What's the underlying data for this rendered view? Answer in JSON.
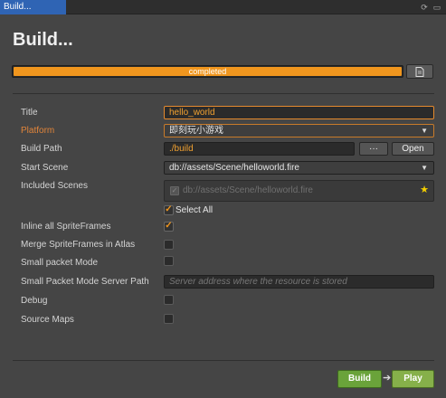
{
  "window": {
    "tab_title": "Build...",
    "icons": [
      "refresh-icon",
      "window-icon"
    ]
  },
  "heading": "Build...",
  "progress": {
    "percent": 100,
    "status_text": "completed",
    "fill_color": "#f0961e"
  },
  "form": {
    "title_label": "Title",
    "title_value": "hello_world",
    "platform_label": "Platform",
    "platform_value": "即刻玩小游戏",
    "build_path_label": "Build Path",
    "build_path_value": "./build",
    "browse_label": "···",
    "open_label": "Open",
    "start_scene_label": "Start Scene",
    "start_scene_value": "db://assets/Scene/helloworld.fire",
    "included_scenes_label": "Included Scenes",
    "included_scene_item": "db://assets/Scene/helloworld.fire",
    "select_all_label": "Select All",
    "select_all_checked": true,
    "inline_spriteframes_label": "Inline all SpriteFrames",
    "inline_spriteframes_checked": true,
    "merge_spriteframes_label": "Merge SpriteFrames in Atlas",
    "merge_spriteframes_checked": false,
    "small_packet_label": "Small packet Mode",
    "small_packet_checked": false,
    "small_packet_server_label": "Small Packet Mode Server Path",
    "small_packet_server_placeholder": "Server address where the resource is stored",
    "debug_label": "Debug",
    "debug_checked": false,
    "source_maps_label": "Source Maps",
    "source_maps_checked": false
  },
  "footer": {
    "build_label": "Build",
    "arrow": "➔",
    "play_label": "Play"
  },
  "colors": {
    "accent": "#f0961e",
    "build_button": "#6aa33a",
    "play_button": "#86b04a",
    "tab_active": "#2f64b4"
  }
}
